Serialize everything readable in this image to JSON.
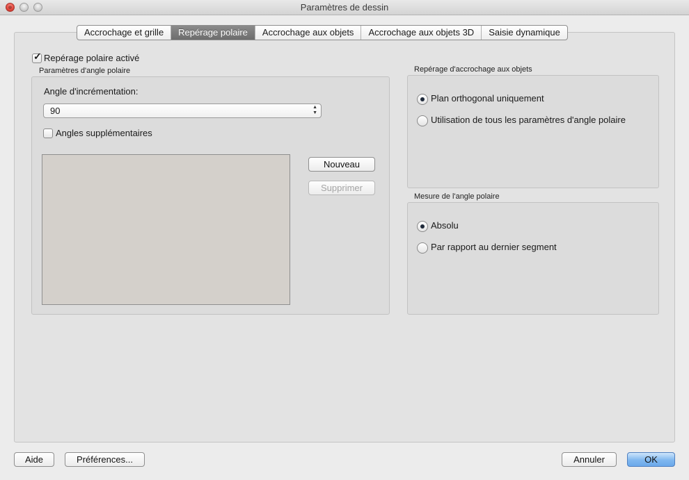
{
  "window": {
    "title": "Paramètres de dessin"
  },
  "tabs": [
    {
      "label": "Accrochage et grille",
      "active": false
    },
    {
      "label": "Repérage polaire",
      "active": true
    },
    {
      "label": "Accrochage aux objets",
      "active": false
    },
    {
      "label": "Accrochage aux objets 3D",
      "active": false
    },
    {
      "label": "Saisie dynamique",
      "active": false
    }
  ],
  "polar_tracking": {
    "enabled_label": "Repérage polaire activé",
    "enabled": true,
    "angle_settings": {
      "group_title": "Paramètres d'angle polaire",
      "increment_label": "Angle d'incrémentation:",
      "increment_value": "90",
      "additional_angles_label": "Angles supplémentaires",
      "additional_angles_checked": false,
      "new_button": "Nouveau",
      "delete_button": "Supprimer"
    },
    "object_snap_tracking": {
      "group_title": "Repérage d'accrochage aux objets",
      "options": [
        {
          "label": "Plan orthogonal uniquement",
          "selected": true
        },
        {
          "label": "Utilisation de tous les paramètres d'angle polaire",
          "selected": false
        }
      ]
    },
    "angle_measurement": {
      "group_title": "Mesure de l'angle polaire",
      "options": [
        {
          "label": "Absolu",
          "selected": true
        },
        {
          "label": "Par rapport au dernier segment",
          "selected": false
        }
      ]
    }
  },
  "footer": {
    "help": "Aide",
    "preferences": "Préférences...",
    "cancel": "Annuler",
    "ok": "OK"
  },
  "colors": {
    "window_bg": "#ececec",
    "panel_bg": "#e3e3e3",
    "active_tab": "#7a7a7a",
    "primary_button": "#7fb7ef"
  }
}
